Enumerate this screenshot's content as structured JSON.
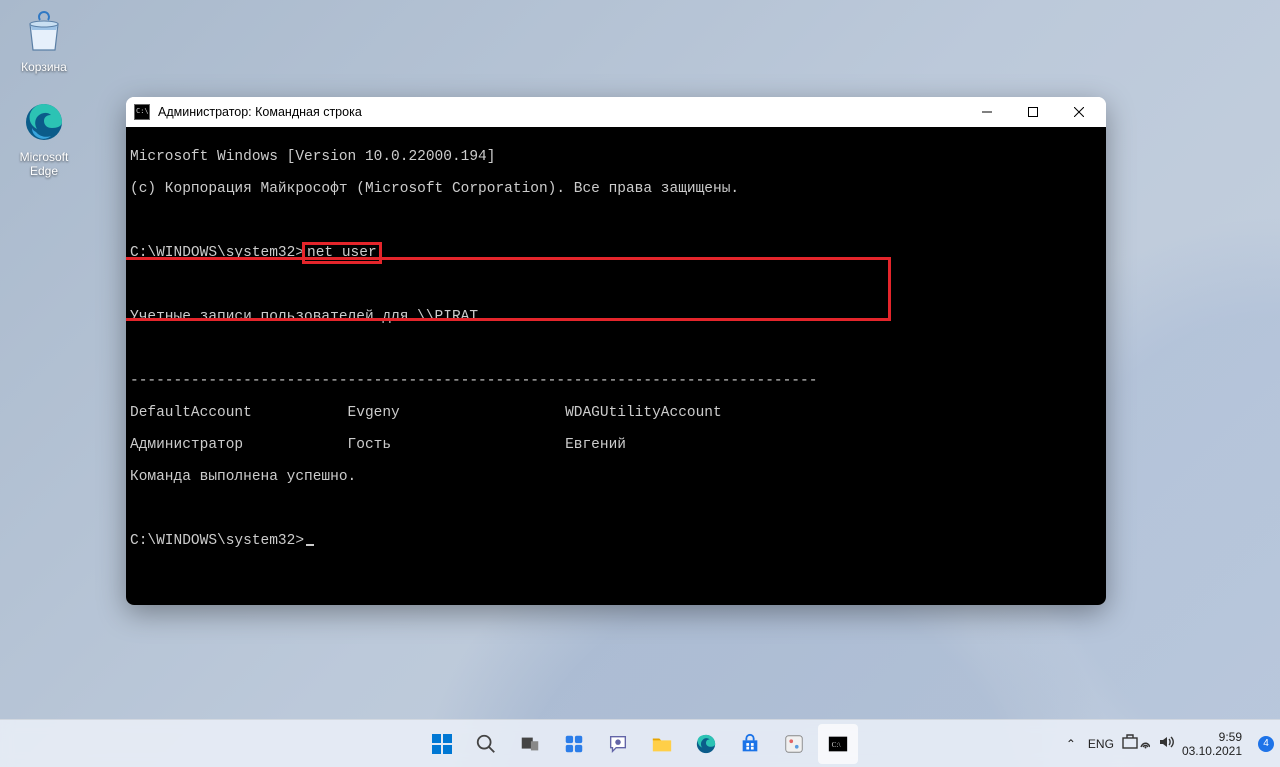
{
  "desktop": {
    "recycle_label": "Корзина",
    "edge_label": "Microsoft Edge"
  },
  "cmd": {
    "title": "Администратор: Командная строка",
    "line1": "Microsoft Windows [Version 10.0.22000.194]",
    "line2": "(c) Корпорация Майкрософт (Microsoft Corporation). Все права защищены.",
    "prompt1": "C:\\WINDOWS\\system32>",
    "command": "net user",
    "accounts_hdr": "Учетные записи пользователей для \\\\PIRAT",
    "dashes": "-------------------------------------------------------------------------------",
    "row1": "DefaultAccount           Evgeny                   WDAGUtilityAccount",
    "row2": "Администратор            Гость                    Евгений",
    "done": "Команда выполнена успешно.",
    "prompt2": "C:\\WINDOWS\\system32>"
  },
  "taskbar": {
    "lang": "ENG",
    "time": "9:59",
    "date": "03.10.2021",
    "notif_count": "4"
  }
}
